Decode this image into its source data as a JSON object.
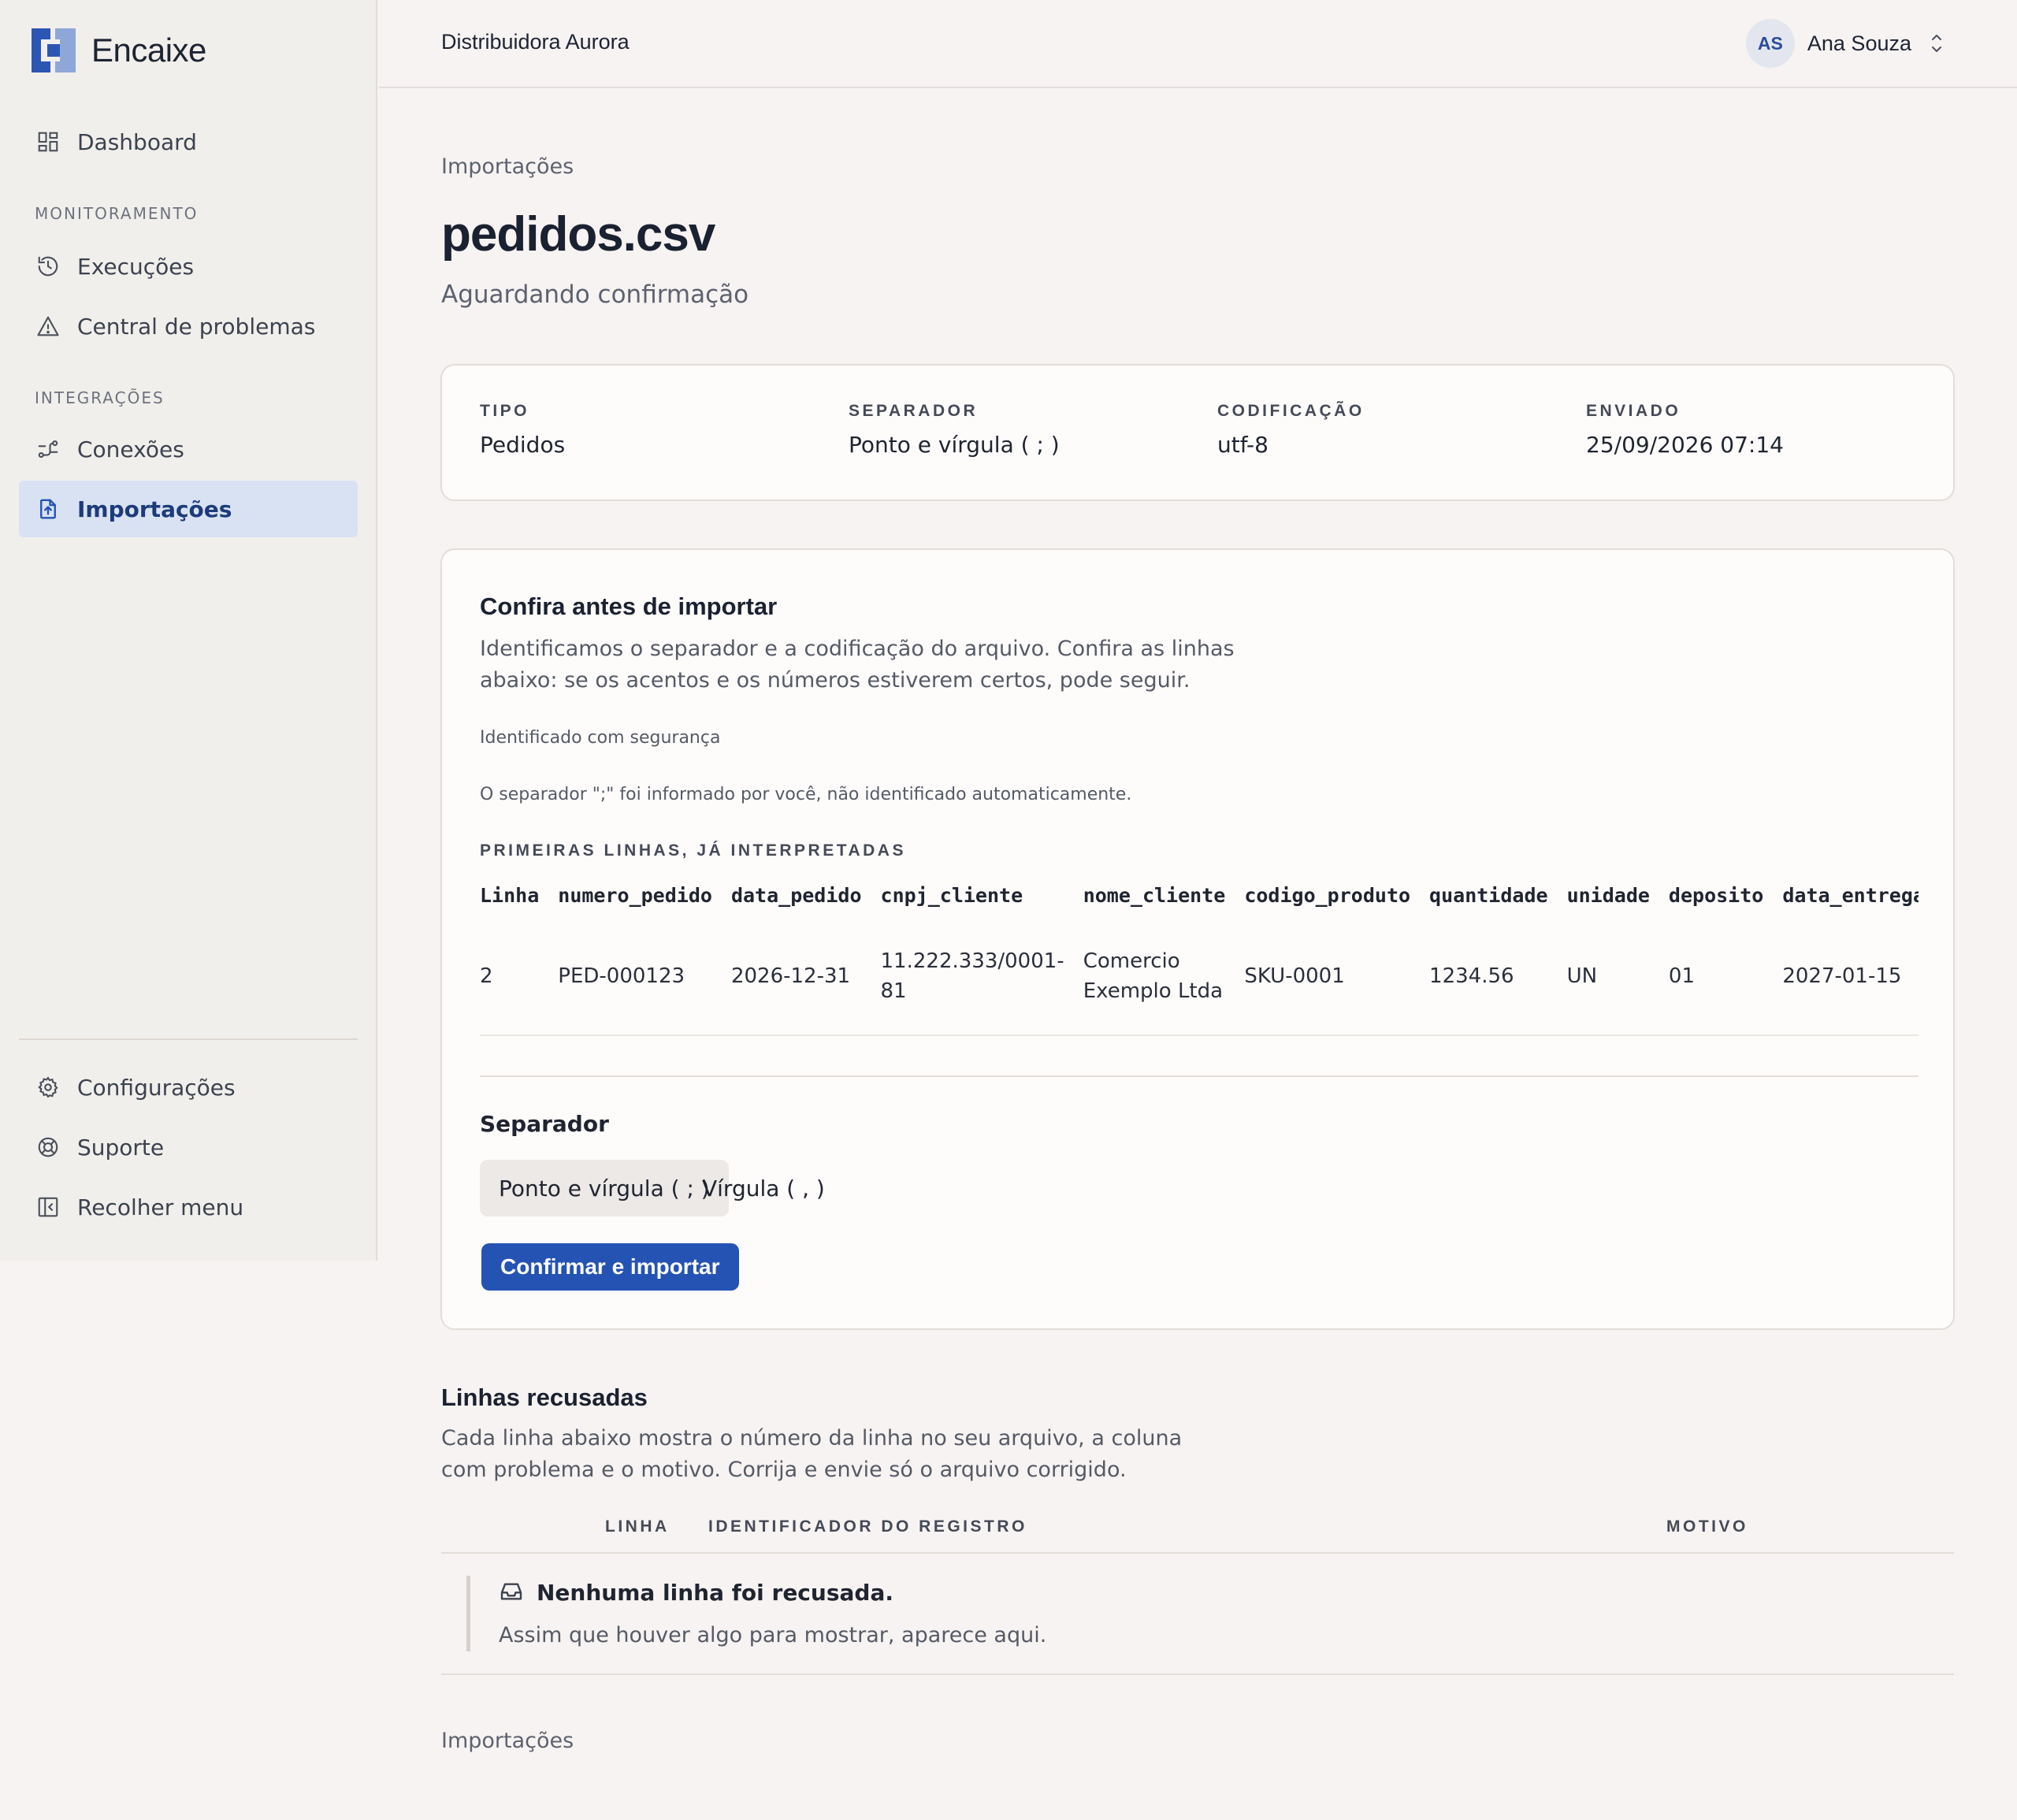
{
  "brand": {
    "name": "Encaixe"
  },
  "sidebar": {
    "dashboard": "Dashboard",
    "section_monitoring": "MONITORAMENTO",
    "executions": "Execuções",
    "problems": "Central de problemas",
    "section_integrations": "INTEGRAÇÕES",
    "connections": "Conexões",
    "imports": "Importações",
    "settings": "Configurações",
    "support": "Suporte",
    "collapse": "Recolher menu"
  },
  "topbar": {
    "org": "Distribuidora Aurora",
    "user_initials": "AS",
    "user_name": "Ana Souza"
  },
  "page": {
    "breadcrumb": "Importações",
    "title": "pedidos.csv",
    "status": "Aguardando confirmação"
  },
  "meta": {
    "type_label": "TIPO",
    "type_value": "Pedidos",
    "separator_label": "SEPARADOR",
    "separator_value": "Ponto e vírgula ( ; )",
    "encoding_label": "CODIFICAÇÃO",
    "encoding_value": "utf-8",
    "sent_label": "ENVIADO",
    "sent_value": "25/09/2026 07:14"
  },
  "confirm": {
    "title": "Confira antes de importar",
    "description": "Identificamos o separador e a codificação do arquivo. Confira as linhas abaixo: se os acentos e os números estiverem certos, pode seguir.",
    "confidence": "Identificado com segurança",
    "separator_note": "O separador \";\" foi informado por você, não identificado automaticamente.",
    "preview_label": "PRIMEIRAS LINHAS, JÁ INTERPRETADAS",
    "columns": [
      "Linha",
      "numero_pedido",
      "data_pedido",
      "cnpj_cliente",
      "nome_cliente",
      "codigo_produto",
      "quantidade",
      "unidade",
      "deposito",
      "data_entrega"
    ],
    "rows": [
      [
        "2",
        "PED-000123",
        "2026-12-31",
        "11.222.333/0001-81",
        "Comercio Exemplo Ltda",
        "SKU-0001",
        "1234.56",
        "UN",
        "01",
        "2027-01-15"
      ]
    ],
    "separator_field_label": "Separador",
    "option_semicolon": "Ponto e vírgula ( ; )",
    "option_comma": "Vírgula ( , )",
    "confirm_button": "Confirmar e importar"
  },
  "rejected": {
    "title": "Linhas recusadas",
    "description": "Cada linha abaixo mostra o número da linha no seu arquivo, a coluna com problema e o motivo. Corrija e envie só o arquivo corrigido.",
    "col_line": "LINHA",
    "col_id": "IDENTIFICADOR DO REGISTRO",
    "col_reason": "MOTIVO",
    "empty_title": "Nenhuma linha foi recusada.",
    "empty_sub": "Assim que houver algo para mostrar, aparece aqui."
  },
  "footer": {
    "breadcrumb": "Importações"
  },
  "colors": {
    "accent": "#2453b3",
    "active_nav_bg": "#d8e2f3",
    "page_bg": "#f7f3f2"
  }
}
